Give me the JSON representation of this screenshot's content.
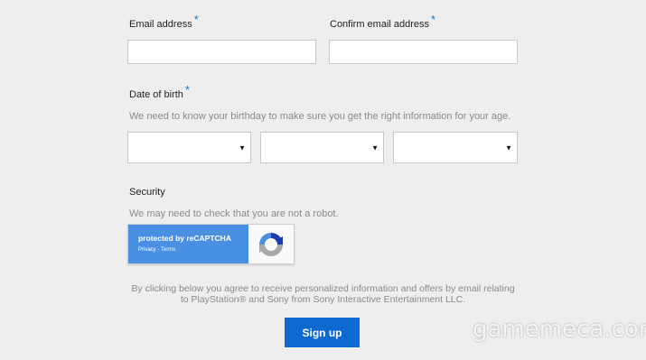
{
  "form": {
    "email_label": "Email address",
    "confirm_email_label": "Confirm email address",
    "required_mark": "*",
    "dob_label": "Date of birth",
    "dob_helper": "We need to know your birthday to make sure you get the right information for your age.",
    "dob_select_caret": "▼",
    "security_label": "Security",
    "security_helper": "We may need to check that you are not a robot.",
    "disclaimer_line1": "By clicking below you agree to receive personalized information and offers by email relating",
    "disclaimer_line2": "to PlayStation® and Sony from Sony Interactive Entertainment LLC.",
    "signup_label": "Sign up"
  },
  "recaptcha": {
    "title": "protected by reCAPTCHA",
    "links": "Privacy - Terms",
    "brand_color": "#4a90e2"
  },
  "watermark": "gamemeca.com",
  "colors": {
    "accent": "#0d6ad0",
    "required": "#1b7bc8"
  }
}
